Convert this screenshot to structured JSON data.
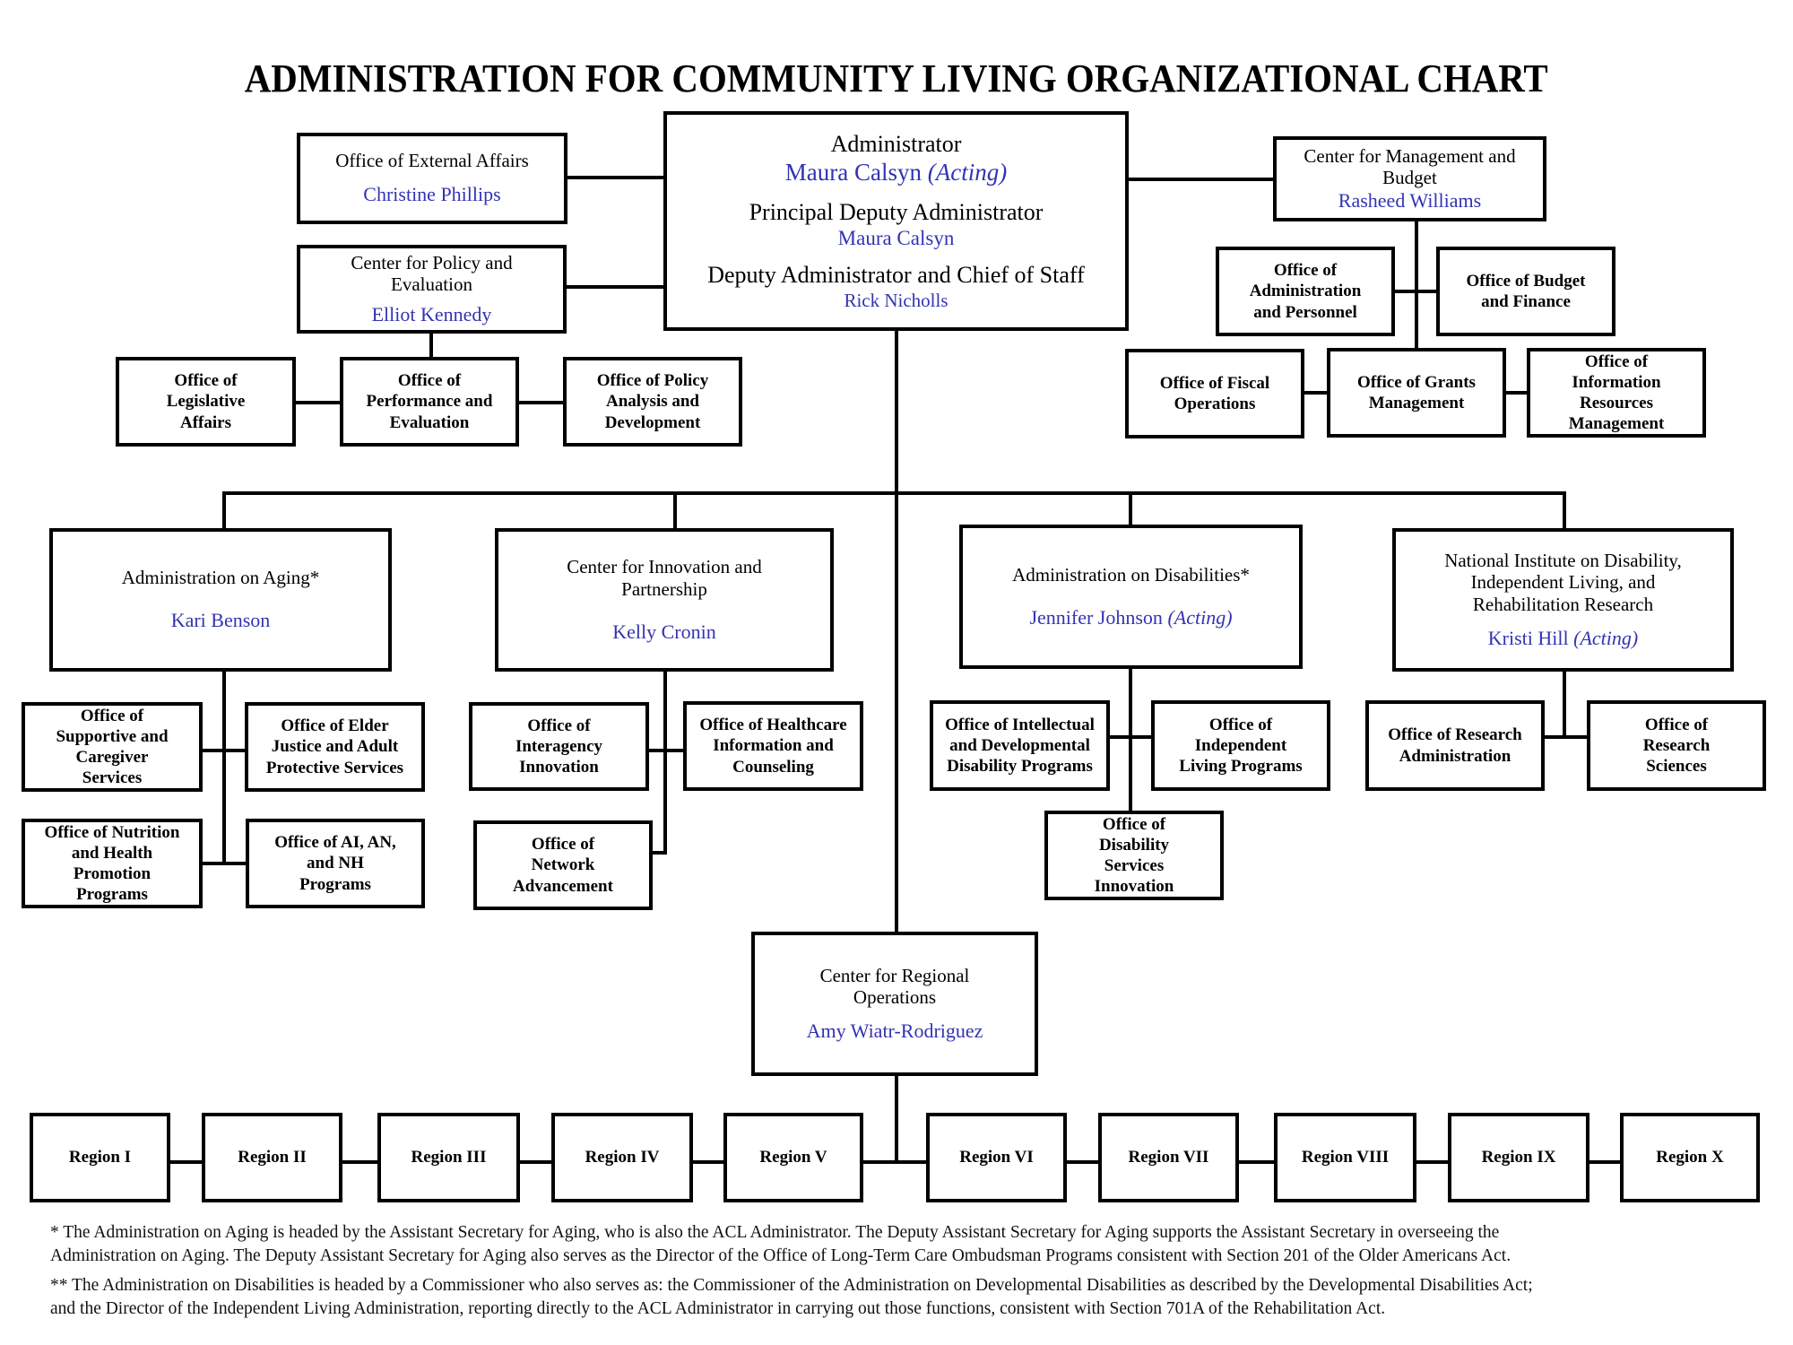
{
  "title": "ADMINISTRATION FOR COMMUNITY LIVING ORGANIZATIONAL CHART",
  "colors": {
    "name_text": "#3333b3",
    "lines": "#000000",
    "box_border": "#000000"
  },
  "administrator": {
    "roles": [
      {
        "title": "Administrator",
        "name": "Maura Calsyn",
        "qualifier": "(Acting)"
      },
      {
        "title": "Principal Deputy Administrator",
        "name": "Maura Calsyn",
        "qualifier": ""
      },
      {
        "title": "Deputy Administrator and Chief of Staff",
        "name": "Rick Nicholls",
        "qualifier": ""
      }
    ]
  },
  "staff_offices": {
    "external_affairs": {
      "title": "Office of External Affairs",
      "name": "Christine Phillips"
    },
    "policy_evaluation": {
      "title": "Center for Policy and Evaluation",
      "name": "Elliot Kennedy",
      "children": [
        "Office of Legislative Affairs",
        "Office of Performance and Evaluation",
        "Office of Policy Analysis and Development"
      ]
    },
    "management_budget": {
      "title": "Center for Management and Budget",
      "name": "Rasheed Williams",
      "children": [
        "Office of Administration and Personnel",
        "Office of Budget and Finance",
        "Office of Fiscal Operations",
        "Office of Grants Management",
        "Office of Information Resources Management"
      ]
    }
  },
  "centers": [
    {
      "title": "Administration on Aging*",
      "name": "Kari Benson",
      "qualifier": "",
      "children": [
        "Office of Supportive and Caregiver Services",
        "Office of Elder Justice and Adult Protective Services",
        "Office of Nutrition and Health Promotion Programs",
        "Office of AI, AN, and NH Programs"
      ]
    },
    {
      "title": "Center for Innovation and Partnership",
      "name": "Kelly Cronin",
      "qualifier": "",
      "children": [
        "Office of Interagency Innovation",
        "Office of Healthcare Information and Counseling",
        "Office of Network Advancement"
      ]
    },
    {
      "title": "Administration on Disabilities*",
      "name": "Jennifer Johnson",
      "qualifier": "(Acting)",
      "children": [
        "Office of Intellectual and Developmental Disability Programs",
        "Office of Independent Living Programs",
        "Office of Disability Services Innovation"
      ]
    },
    {
      "title": "National Institute on Disability, Independent Living, and Rehabilitation Research",
      "name": "Kristi Hill",
      "qualifier": "(Acting)",
      "children": [
        "Office of Research Administration",
        "Office of Research Sciences"
      ]
    }
  ],
  "regional": {
    "title": "Center for Regional Operations",
    "name": "Amy Wiatr-Rodriguez",
    "regions": [
      "Region I",
      "Region II",
      "Region III",
      "Region IV",
      "Region V",
      "Region VI",
      "Region VII",
      "Region VIII",
      "Region IX",
      "Region X"
    ]
  },
  "footnotes": [
    {
      "line1": "* The Administration on Aging is headed by the Assistant Secretary for Aging, who is also the ACL Administrator. The Deputy Assistant Secretary for Aging supports the Assistant Secretary in overseeing the",
      "line2": "Administration on Aging.  The Deputy Assistant Secretary for Aging also serves as the Director of the Office of Long-Term Care Ombudsman Programs consistent with Section 201 of the Older Americans Act."
    },
    {
      "line1": "** The Administration on Disabilities is headed by a Commissioner who also serves as: the Commissioner of the Administration on Developmental Disabilities as described by the Developmental Disabilities Act;",
      "line2": "and the Director of the Independent Living Administration, reporting directly to the ACL Administrator in carrying out those functions, consistent with Section 701A of the Rehabilitation Act."
    }
  ]
}
